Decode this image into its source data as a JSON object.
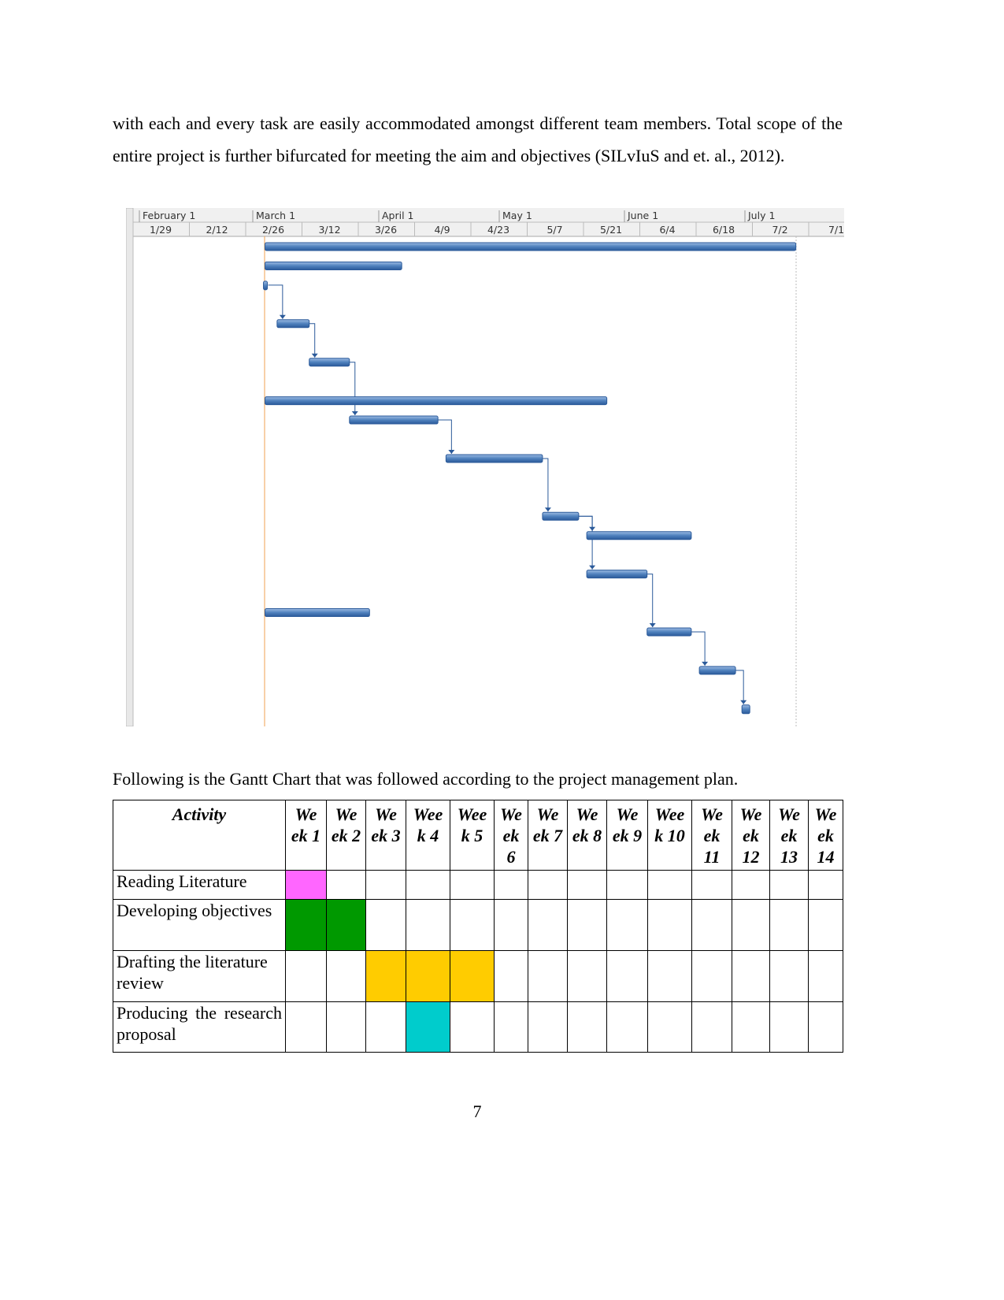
{
  "body_text": "with each and every task are easily accommodated amongst different team members. Total scope of the entire project is further bifurcated for meeting the aim and objectives (SILvIuS and et. al., 2012).",
  "chart_data": {
    "type": "gantt",
    "months": [
      "February 1",
      "March 1",
      "April 1",
      "May 1",
      "June 1",
      "July 1"
    ],
    "week_ticks": [
      "1/29",
      "2/12",
      "2/26",
      "3/12",
      "3/26",
      "4/9",
      "4/23",
      "5/7",
      "5/21",
      "6/4",
      "6/18",
      "7/2",
      "7/1"
    ],
    "tasks": [
      {
        "row": 0,
        "start": "3/2",
        "end": "7/12",
        "kind": "summary"
      },
      {
        "row": 1,
        "start": "3/2",
        "end": "4/5",
        "kind": "task"
      },
      {
        "row": 2,
        "start": "3/2",
        "end": "3/2",
        "kind": "milestone"
      },
      {
        "row": 4,
        "start": "3/5",
        "end": "3/13",
        "kind": "task"
      },
      {
        "row": 6,
        "start": "3/13",
        "end": "3/23",
        "kind": "task"
      },
      {
        "row": 8,
        "start": "3/2",
        "end": "5/26",
        "kind": "summary"
      },
      {
        "row": 9,
        "start": "3/23",
        "end": "4/14",
        "kind": "task"
      },
      {
        "row": 11,
        "start": "4/16",
        "end": "5/10",
        "kind": "task"
      },
      {
        "row": 14,
        "start": "5/10",
        "end": "5/19",
        "kind": "task"
      },
      {
        "row": 15,
        "start": "5/21",
        "end": "6/16",
        "kind": "task"
      },
      {
        "row": 17,
        "start": "5/21",
        "end": "6/5",
        "kind": "task"
      },
      {
        "row": 19,
        "start": "3/2",
        "end": "3/28",
        "kind": "summary"
      },
      {
        "row": 20,
        "start": "6/5",
        "end": "6/16",
        "kind": "task"
      },
      {
        "row": 22,
        "start": "6/18",
        "end": "6/27",
        "kind": "task"
      },
      {
        "row": 24,
        "start": "6/28",
        "end": "6/28",
        "kind": "milestone"
      }
    ],
    "links": [
      [
        2,
        3
      ],
      [
        3,
        4
      ],
      [
        4,
        6
      ],
      [
        6,
        7
      ],
      [
        7,
        8
      ],
      [
        8,
        9
      ],
      [
        8,
        10
      ],
      [
        10,
        12
      ],
      [
        12,
        13
      ],
      [
        13,
        14
      ]
    ],
    "bar_color": "#4f81bd"
  },
  "caption": "Following is the Gantt Chart that was followed according to the project management plan.",
  "table": {
    "header": [
      "Activity",
      "We ek 1",
      "We ek 2",
      "We ek 3",
      "Wee k 4",
      "Wee k 5",
      "We ek 6",
      "We ek 7",
      "We ek 8",
      "We ek 9",
      "Wee k 10",
      "We ek 11",
      "We ek 12",
      "We ek 13",
      "We ek 14"
    ],
    "rows": [
      {
        "activity": "Reading Literature",
        "weeks": [
          1
        ],
        "color": "#ff66ff"
      },
      {
        "activity": "Developing objectives",
        "weeks": [
          1,
          2
        ],
        "color": "#009900"
      },
      {
        "activity": "Drafting the literature review",
        "weeks": [
          3,
          4,
          5
        ],
        "color": "#ffcc00"
      },
      {
        "activity": "Producing the research proposal",
        "weeks": [
          4
        ],
        "color": "#00cccc"
      }
    ]
  },
  "page_number": "7"
}
